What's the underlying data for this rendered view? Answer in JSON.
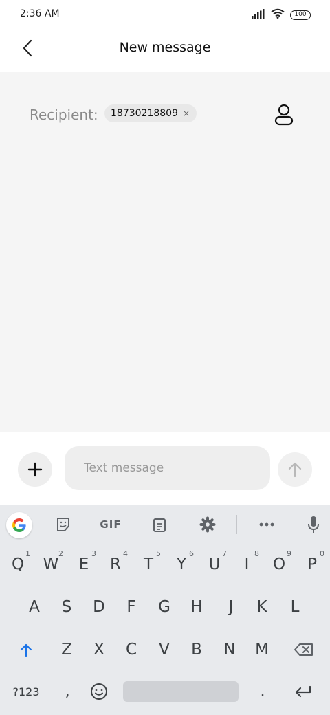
{
  "status_bar": {
    "time": "2:36 AM",
    "battery": "100"
  },
  "header": {
    "title": "New message"
  },
  "recipient": {
    "label": "Recipient:",
    "chip": "18730218809",
    "remove_symbol": "×"
  },
  "compose": {
    "placeholder": "Text message"
  },
  "keyboard": {
    "toolbar": {
      "gif_label": "GIF"
    },
    "row1": [
      {
        "key": "Q",
        "hint": "1"
      },
      {
        "key": "W",
        "hint": "2"
      },
      {
        "key": "E",
        "hint": "3"
      },
      {
        "key": "R",
        "hint": "4"
      },
      {
        "key": "T",
        "hint": "5"
      },
      {
        "key": "Y",
        "hint": "6"
      },
      {
        "key": "U",
        "hint": "7"
      },
      {
        "key": "I",
        "hint": "8"
      },
      {
        "key": "O",
        "hint": "9"
      },
      {
        "key": "P",
        "hint": "0"
      }
    ],
    "row2": [
      "A",
      "S",
      "D",
      "F",
      "G",
      "H",
      "J",
      "K",
      "L"
    ],
    "row3": [
      "Z",
      "X",
      "C",
      "V",
      "B",
      "N",
      "M"
    ],
    "row4": {
      "symbols_label": "?123",
      "comma": ",",
      "period": "."
    }
  },
  "colors": {
    "accent_shift": "#1a73e8",
    "content_bg": "#f5f5f5",
    "keyboard_bg": "#e8eaed"
  }
}
